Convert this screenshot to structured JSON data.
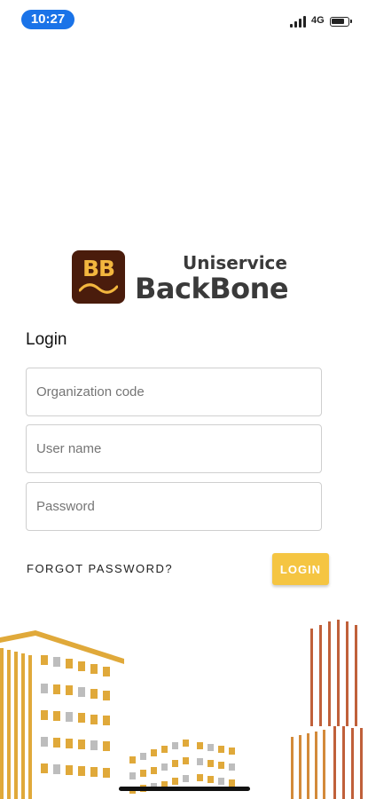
{
  "status_bar": {
    "time": "10:27",
    "network": "4G",
    "time_color": "#1a73e8"
  },
  "logo": {
    "mark_text": "BB",
    "brand_top": "Uniservice",
    "brand_main": "BackBone",
    "mark_bg": "#4a1c0c",
    "mark_fg": "#f3b63e"
  },
  "form": {
    "heading": "Login",
    "fields": [
      {
        "placeholder": "Organization code",
        "value": ""
      },
      {
        "placeholder": "User name",
        "value": ""
      },
      {
        "placeholder": "Password",
        "value": ""
      }
    ],
    "forgot_label": "FORGOT PASSWORD?",
    "login_label": "LOGIN",
    "accent": "#f5c542"
  },
  "illustration": {
    "name": "city-buildings",
    "colors": [
      "#e0a93a",
      "#d38a3a",
      "#c0603a",
      "#bdbdbd"
    ]
  }
}
